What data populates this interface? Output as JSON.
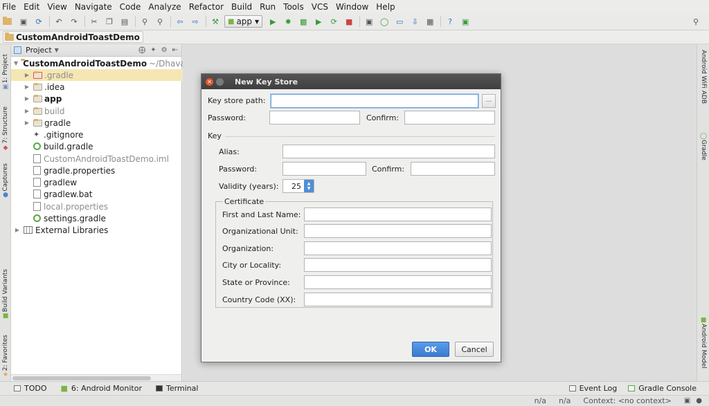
{
  "menu": [
    "File",
    "Edit",
    "View",
    "Navigate",
    "Code",
    "Analyze",
    "Refactor",
    "Build",
    "Run",
    "Tools",
    "VCS",
    "Window",
    "Help"
  ],
  "toolbar": {
    "run_config": "app"
  },
  "breadcrumb": {
    "project": "CustomAndroidToastDemo"
  },
  "left_tabs": [
    "1: Project",
    "7: Structure",
    "Captures",
    "Build Variants",
    "2: Favorites"
  ],
  "right_tabs": [
    "Android WiFi ADB",
    "Gradle",
    "Android Model"
  ],
  "project_panel": {
    "title": "Project",
    "root": "CustomAndroidToastDemo",
    "root_path": "~/Dhaval/A",
    "items": [
      ".gradle",
      ".idea",
      "app",
      "build",
      "gradle",
      ".gitignore",
      "build.gradle",
      "CustomAndroidToastDemo.iml",
      "gradle.properties",
      "gradlew",
      "gradlew.bat",
      "local.properties",
      "settings.gradle",
      "External Libraries"
    ]
  },
  "bottom_tools": {
    "todo": "TODO",
    "android_monitor": "6: Android Monitor",
    "terminal": "Terminal",
    "event_log": "Event Log",
    "gradle_console": "Gradle Console"
  },
  "status": {
    "pos1": "n/a",
    "pos2": "n/a",
    "context": "Context: <no context>"
  },
  "dialog": {
    "title": "New Key Store",
    "key_store_path_label": "Key store path:",
    "key_store_path": "",
    "browse": "...",
    "password_label": "Password:",
    "confirm_label": "Confirm:",
    "key_section": "Key",
    "alias_label": "Alias:",
    "key_password_label": "Password:",
    "key_confirm_label": "Confirm:",
    "validity_label": "Validity (years):",
    "validity_value": "25",
    "certificate_section": "Certificate",
    "first_last_name_label": "First and Last Name:",
    "org_unit_label": "Organizational Unit:",
    "organization_label": "Organization:",
    "city_label": "City or Locality:",
    "state_label": "State or Province:",
    "country_label": "Country Code (XX):",
    "ok": "OK",
    "cancel": "Cancel"
  }
}
